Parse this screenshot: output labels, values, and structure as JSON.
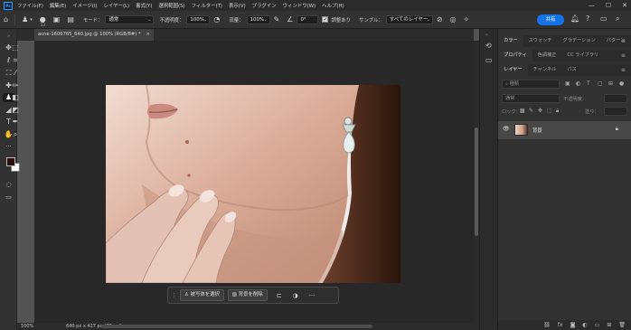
{
  "app": {
    "logo": "Ps"
  },
  "menu": [
    "ファイル(F)",
    "編集(E)",
    "イメージ(I)",
    "レイヤー(L)",
    "書式(Y)",
    "選択範囲(S)",
    "フィルター(T)",
    "表示(V)",
    "プラグイン",
    "ウィンドウ(W)",
    "ヘルプ(H)"
  ],
  "window_controls": {
    "minimize": "—",
    "maximize": "☐",
    "close": "✕"
  },
  "options": {
    "brush_size": "13",
    "mode_label": "モード：",
    "mode_value": "通常",
    "opacity_label": "不透明度：",
    "opacity_value": "100%",
    "flow_label": "流量：",
    "flow_value": "100%",
    "angle_value": "0°",
    "align_label": "調整あり",
    "sample_label": "サンプル：",
    "sample_value": "すべてのレイヤー",
    "share": "共有"
  },
  "document": {
    "tab": "acne-1606765_640.jpg @ 100% (RGB/8#) *",
    "close": "×"
  },
  "status": {
    "zoom": "100%",
    "size": "640 px x 427 px (72 ppi)"
  },
  "taskbar": {
    "select_subject": "被写体を選択",
    "remove_bg": "背景を削除",
    "more": "···"
  },
  "panels": {
    "top_tabs": [
      "カラー",
      "スウォッチ",
      "グラデーション",
      "パターン"
    ],
    "mid_tabs": [
      "プロパティ",
      "色調補正",
      "CC ライブラリ"
    ],
    "layer_tabs": [
      "レイヤー",
      "チャンネル",
      "パス"
    ],
    "filter_placeholder": "種類",
    "blend_mode": "通常",
    "opacity_label": "不透明度：",
    "lock_label": "ロック：",
    "fill_label": "塗り：",
    "layer_name": "背景",
    "bottom_fx": "fx"
  },
  "colors": {
    "accent": "#1473e6",
    "foreground": "#2a0f0a",
    "background": "#ffffff"
  }
}
